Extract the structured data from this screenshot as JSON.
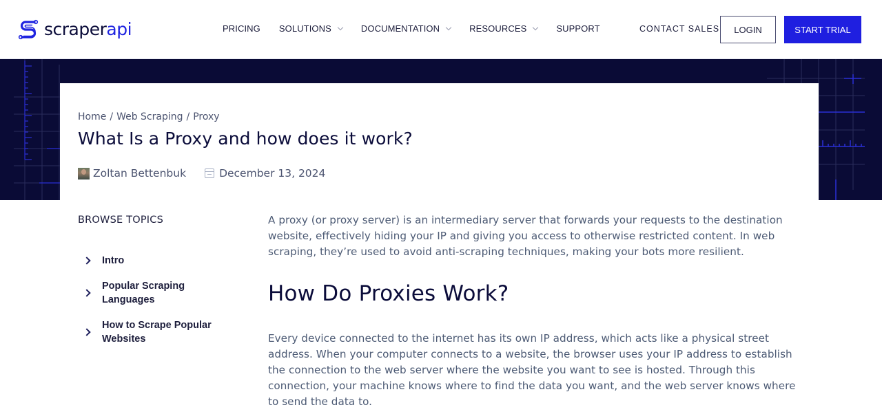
{
  "brand": {
    "logo_icon": "scraperapi-s-logo-icon",
    "name_part1": "scraper",
    "name_part2": "api",
    "colors": {
      "navy": "#0b0c3a",
      "accent": "#1f1fe0",
      "hero_bg": "#0a0b36"
    }
  },
  "nav": {
    "items": [
      {
        "label": "PRICING",
        "has_dropdown": false
      },
      {
        "label": "SOLUTIONS",
        "has_dropdown": true
      },
      {
        "label": "DOCUMENTATION",
        "has_dropdown": true
      },
      {
        "label": "RESOURCES",
        "has_dropdown": true
      },
      {
        "label": "SUPPORT",
        "has_dropdown": false
      }
    ],
    "contact_sales": "CONTACT SALES",
    "login": "LOGIN",
    "start_trial": "START TRIAL"
  },
  "article": {
    "breadcrumb": [
      "Home",
      "Web Scraping",
      "Proxy"
    ],
    "breadcrumb_separator": "/",
    "title": "What Is a Proxy and how does it work?",
    "author": "Zoltan Bettenbuk",
    "date": "December 13, 2024",
    "intro": "A proxy (or proxy server) is an intermediary server that forwards your requests to the destination website, effectively hiding your IP and giving you access to otherwise restricted content. In web scraping, they’re used to avoid anti-scraping techniques, making your bots more resilient.",
    "section_heading": "How Do Proxies Work?",
    "section_para": "Every device connected to the internet has its own IP address, which acts like a physical street address. When your computer connects to a website, the browser uses your IP address to establish the connection to the web server where the website you want to see is hosted. Through this connection, your machine knows where to find the data you want, and the web server knows where to send the data to."
  },
  "sidebar": {
    "title": "BROWSE TOPICS",
    "items": [
      {
        "label": "Intro"
      },
      {
        "label": "Popular Scraping Languages"
      },
      {
        "label": "How to Scrape Popular Websites"
      }
    ]
  }
}
